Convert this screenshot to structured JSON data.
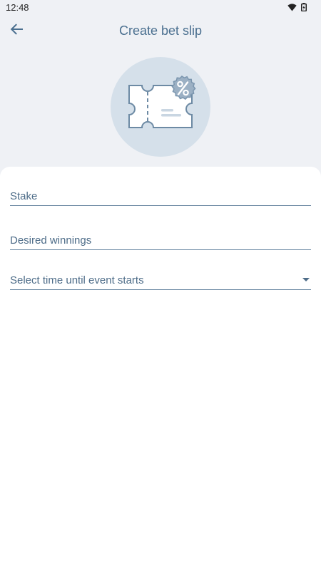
{
  "status_bar": {
    "time": "12:48",
    "icons": [
      "wifi-icon",
      "battery-icon"
    ]
  },
  "app_bar": {
    "back_icon": "arrow-left-icon",
    "title": "Create bet slip"
  },
  "illustration": {
    "icon": "ticket-percent-icon",
    "badge_symbol": "%"
  },
  "form": {
    "stake_label": "Stake",
    "winnings_label": "Desired winnings",
    "time_select_label": "Select time until event starts",
    "time_select_icon": "chevron-down-icon"
  },
  "colors": {
    "background": "#eff1f5",
    "sheet": "#ffffff",
    "accent": "#4a6f8f",
    "illustration_circle": "#d5e0ea"
  }
}
